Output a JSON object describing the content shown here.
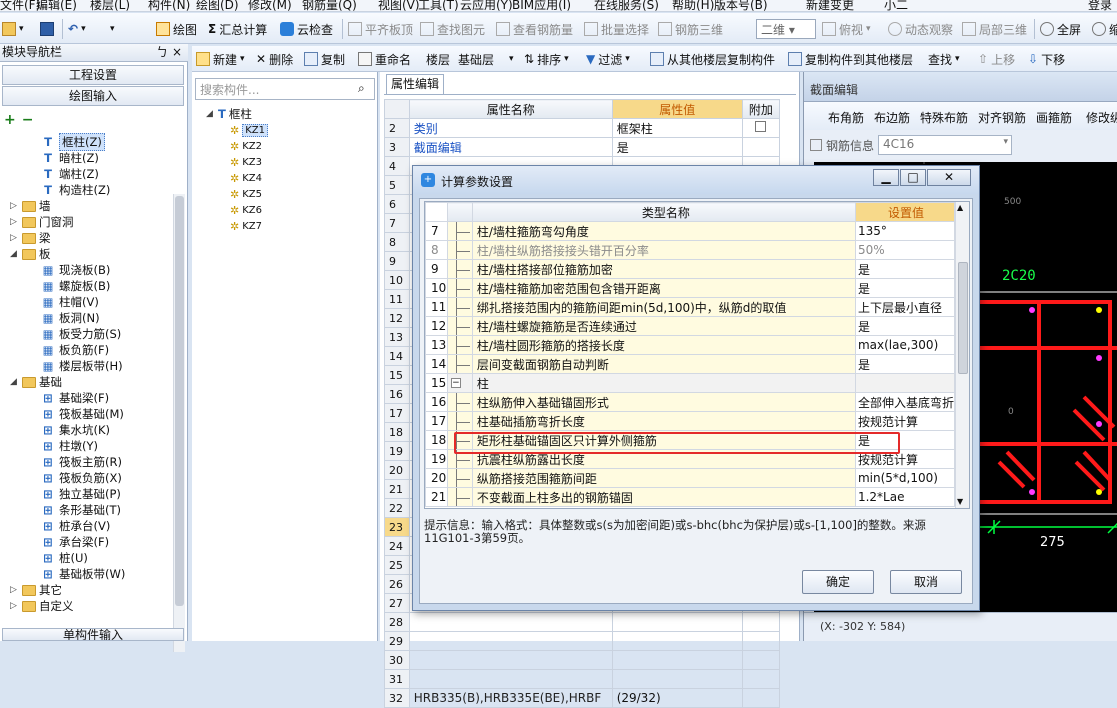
{
  "menubar": {
    "items": [
      "文件(F)",
      "编辑(E)",
      "楼层(L)",
      "构件(N)",
      "绘图(D)",
      "修改(M)",
      "钢筋量(Q)",
      "视图(V)",
      "工具(T)",
      "云应用(Y)",
      "BIM应用(I)",
      "在线服务(S)",
      "帮助(H)",
      "版本号(B)",
      "新建变更",
      "小二",
      "登录"
    ]
  },
  "toolbar1": {
    "draw": "绘图",
    "summary": "汇总计算",
    "cloud_check": "云检查",
    "flat_board": "平齐板顶",
    "find_elem": "查找图元",
    "view_rebar": "查看钢筋量",
    "batch_select": "批量选择",
    "rebar_3d": "钢筋三维",
    "view_mode": "二维",
    "top_view": "俯视",
    "dynamic_view": "动态观察",
    "local_3d": "局部三维",
    "fullscreen": "全屏",
    "zoom_out": "缩小"
  },
  "toolbar2": {
    "new": "新建",
    "delete": "删除",
    "copy": "复制",
    "rename": "重命名",
    "floor_label": "楼层",
    "floor_value": "基础层",
    "sort": "排序",
    "filter": "过滤",
    "copy_from_other": "从其他楼层复制构件",
    "copy_to_other": "复制构件到其他楼层",
    "find": "查找",
    "move_up": "上移",
    "move_down": "下移"
  },
  "nav": {
    "title": "模块导航栏",
    "pin": "ㄅ ×",
    "engineering_settings": "工程设置",
    "drawing_input": "绘图输入",
    "single_input": "单构件输入",
    "tree": [
      {
        "label": "框柱(Z)",
        "level": 2,
        "icon": "column-icon",
        "selected": true
      },
      {
        "label": "暗柱(Z)",
        "level": 2,
        "icon": "column-icon"
      },
      {
        "label": "端柱(Z)",
        "level": 2,
        "icon": "column-icon"
      },
      {
        "label": "构造柱(Z)",
        "level": 2,
        "icon": "column-icon"
      },
      {
        "label": "墙",
        "level": 1,
        "icon": "folder-icon",
        "exp": "+"
      },
      {
        "label": "门窗洞",
        "level": 1,
        "icon": "folder-icon",
        "exp": "+"
      },
      {
        "label": "梁",
        "level": 1,
        "icon": "folder-icon",
        "exp": "+"
      },
      {
        "label": "板",
        "level": 1,
        "icon": "folder-icon",
        "exp": "-"
      },
      {
        "label": "现浇板(B)",
        "level": 2,
        "icon": "slab-icon"
      },
      {
        "label": "螺旋板(B)",
        "level": 2,
        "icon": "slab-icon"
      },
      {
        "label": "柱帽(V)",
        "level": 2,
        "icon": "slab-icon"
      },
      {
        "label": "板洞(N)",
        "level": 2,
        "icon": "slab-icon"
      },
      {
        "label": "板受力筋(S)",
        "level": 2,
        "icon": "slab-icon"
      },
      {
        "label": "板负筋(F)",
        "level": 2,
        "icon": "slab-icon"
      },
      {
        "label": "楼层板带(H)",
        "level": 2,
        "icon": "slab-icon"
      },
      {
        "label": "基础",
        "level": 1,
        "icon": "folder-icon",
        "exp": "-"
      },
      {
        "label": "基础梁(F)",
        "level": 2,
        "icon": "foundation-icon"
      },
      {
        "label": "筏板基础(M)",
        "level": 2,
        "icon": "foundation-icon"
      },
      {
        "label": "集水坑(K)",
        "level": 2,
        "icon": "foundation-icon"
      },
      {
        "label": "柱墩(Y)",
        "level": 2,
        "icon": "foundation-icon"
      },
      {
        "label": "筏板主筋(R)",
        "level": 2,
        "icon": "foundation-icon"
      },
      {
        "label": "筏板负筋(X)",
        "level": 2,
        "icon": "foundation-icon"
      },
      {
        "label": "独立基础(P)",
        "level": 2,
        "icon": "foundation-icon"
      },
      {
        "label": "条形基础(T)",
        "level": 2,
        "icon": "foundation-icon"
      },
      {
        "label": "桩承台(V)",
        "level": 2,
        "icon": "foundation-icon"
      },
      {
        "label": "承台梁(F)",
        "level": 2,
        "icon": "foundation-icon"
      },
      {
        "label": "桩(U)",
        "level": 2,
        "icon": "foundation-icon"
      },
      {
        "label": "基础板带(W)",
        "level": 2,
        "icon": "foundation-icon"
      },
      {
        "label": "其它",
        "level": 1,
        "icon": "folder-icon",
        "exp": "+"
      },
      {
        "label": "自定义",
        "level": 1,
        "icon": "folder-icon",
        "exp": "+"
      }
    ]
  },
  "components": {
    "search_placeholder": "搜索构件...",
    "root": "框柱",
    "items": [
      "KZ1",
      "KZ2",
      "KZ3",
      "KZ4",
      "KZ5",
      "KZ6",
      "KZ7"
    ]
  },
  "props": {
    "tab": "属性编辑",
    "col_name": "属性名称",
    "col_value": "属性值",
    "col_extra": "附加",
    "rows": [
      {
        "n": "2",
        "name": "类别",
        "value": "框架柱"
      },
      {
        "n": "3",
        "name": "截面编辑",
        "value": "是"
      },
      {
        "n": "4",
        "name": "",
        "value": ""
      },
      {
        "n": "5",
        "name": "",
        "value": ""
      },
      {
        "n": "6",
        "name": "",
        "value": ""
      },
      {
        "n": "7",
        "name": "",
        "value": ""
      },
      {
        "n": "8",
        "name": "",
        "value": ""
      },
      {
        "n": "9",
        "name": "",
        "value": ""
      },
      {
        "n": "10",
        "name": "",
        "value": ""
      },
      {
        "n": "11",
        "name": "",
        "value": ""
      },
      {
        "n": "12",
        "name": "",
        "value": ""
      },
      {
        "n": "13",
        "name": "",
        "value": ""
      },
      {
        "n": "14",
        "name": "",
        "value": ""
      },
      {
        "n": "15",
        "name": "",
        "value": ""
      },
      {
        "n": "16",
        "name": "",
        "value": ""
      },
      {
        "n": "17",
        "name": "",
        "value": ""
      },
      {
        "n": "18",
        "name": "",
        "value": ""
      },
      {
        "n": "19",
        "name": "",
        "value": ""
      },
      {
        "n": "20",
        "name": "",
        "value": ""
      },
      {
        "n": "21",
        "name": "",
        "value": ""
      },
      {
        "n": "22",
        "name": "",
        "value": ""
      },
      {
        "n": "23",
        "name": "",
        "value": ""
      },
      {
        "n": "24",
        "name": "",
        "value": ""
      },
      {
        "n": "25",
        "name": "",
        "value": ""
      },
      {
        "n": "26",
        "name": "",
        "value": ""
      },
      {
        "n": "27",
        "name": "",
        "value": ""
      },
      {
        "n": "28",
        "name": "",
        "value": ""
      },
      {
        "n": "29",
        "name": "",
        "value": ""
      },
      {
        "n": "30",
        "name": "",
        "value": ""
      },
      {
        "n": "31",
        "name": "",
        "value": ""
      },
      {
        "n": "32",
        "name": "HRB335(B),HRB335E(BE),HRBF",
        "value": "(29/32)"
      }
    ]
  },
  "section": {
    "title": "截面编辑",
    "tools": [
      "布角筋",
      "布边筋",
      "特殊布筋",
      "对齐钢筋",
      "画箍筋",
      "修改纵"
    ],
    "rebar_label": "钢筋信息",
    "rebar_value": "4C16",
    "annotation": "2C20",
    "dim": "275",
    "coord": "(X: -302 Y: 584)",
    "ruler": [
      "500",
      "0"
    ]
  },
  "dialog": {
    "title": "计算参数设置",
    "col_type": "类型名称",
    "col_value": "设置值",
    "rows": [
      {
        "n": "7",
        "name": "柱/墙柱箍筋弯勾角度",
        "value": "135°"
      },
      {
        "n": "8",
        "name": "柱/墙柱纵筋搭接接头错开百分率",
        "value": "50%",
        "dim": true
      },
      {
        "n": "9",
        "name": "柱/墙柱搭接部位箍筋加密",
        "value": "是"
      },
      {
        "n": "10",
        "name": "柱/墙柱箍筋加密范围包含错开距离",
        "value": "是"
      },
      {
        "n": "11",
        "name": "绑扎搭接范围内的箍筋间距min(5d,100)中，纵筋d的取值",
        "value": "上下层最小直径"
      },
      {
        "n": "12",
        "name": "柱/墙柱螺旋箍筋是否连续通过",
        "value": "是"
      },
      {
        "n": "13",
        "name": "柱/墙柱圆形箍筋的搭接长度",
        "value": "max(lae,300)"
      },
      {
        "n": "14",
        "name": "层间变截面钢筋自动判断",
        "value": "是"
      },
      {
        "n": "15",
        "name": "柱",
        "value": "",
        "group": true
      },
      {
        "n": "16",
        "name": "柱纵筋伸入基础锚固形式",
        "value": "全部伸入基底弯折"
      },
      {
        "n": "17",
        "name": "柱基础插筋弯折长度",
        "value": "按规范计算"
      },
      {
        "n": "18",
        "name": "矩形柱基础锚固区只计算外侧箍筋",
        "value": "是",
        "highlight": true
      },
      {
        "n": "19",
        "name": "抗震柱纵筋露出长度",
        "value": "按规范计算"
      },
      {
        "n": "20",
        "name": "纵筋搭接范围箍筋间距",
        "value": "min(5*d,100)"
      },
      {
        "n": "21",
        "name": "不变截面上柱多出的钢筋锚固",
        "value": "1.2*Lae"
      }
    ],
    "hint": "提示信息：输入格式：具体整数或s(s为加密间距)或s-bhc(bhc为保护层)或s-[1,100]的整数。来源11G101-3第59页。",
    "ok": "确定",
    "cancel": "取消"
  },
  "colors": {
    "accent": "#ff0000",
    "selected": "#cfe2fb",
    "value_header": "#f7d98a",
    "canvas": "#000000",
    "rebar": "#ff1a1a",
    "dim_line": "#00ff40"
  }
}
